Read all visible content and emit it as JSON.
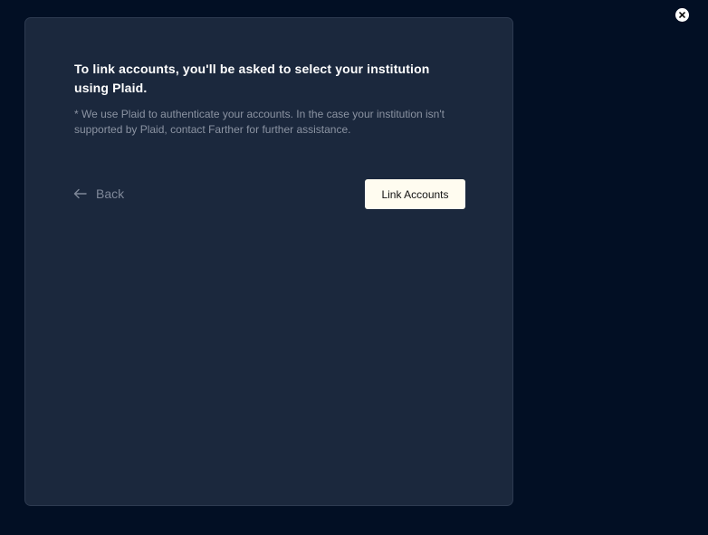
{
  "dialog": {
    "heading": "To link accounts, you'll be asked to select your institution using Plaid.",
    "note": "* We use Plaid to authenticate your accounts. In the case your institution isn't supported by Plaid, contact Farther for further assistance.",
    "back_label": "Back",
    "link_accounts_label": "Link Accounts"
  },
  "icons": {
    "close": "close-icon",
    "back": "arrow-left-icon"
  },
  "colors": {
    "background": "#020f24",
    "panel": "#1b283d",
    "button": "#fffcf0"
  }
}
